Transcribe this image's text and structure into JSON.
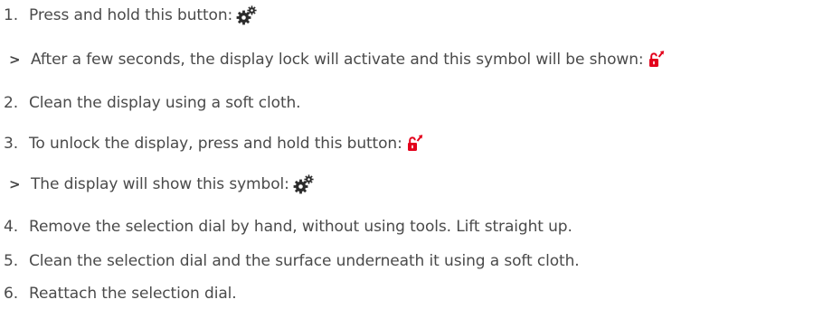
{
  "steps": [
    {
      "marker": "1.",
      "text": "Press and hold this button:",
      "icon": "gear-icon"
    },
    {
      "marker": ">",
      "text": "After a few seconds, the display lock will activate and this symbol will be shown:",
      "icon": "lock-open-icon"
    },
    {
      "marker": "2.",
      "text": "Clean the display using a soft cloth."
    },
    {
      "marker": "3.",
      "text": "To unlock the display, press and hold this button:",
      "icon": "lock-open-icon"
    },
    {
      "marker": ">",
      "text": "The display will show this symbol:",
      "icon": "gear-icon"
    },
    {
      "marker": "4.",
      "text": "Remove the selection dial by hand, without using tools. Lift straight up."
    },
    {
      "marker": "5.",
      "text": "Clean the selection dial and the surface underneath it using a soft cloth."
    },
    {
      "marker": "6.",
      "text": "Reattach the selection dial."
    }
  ],
  "colors": {
    "text": "#4a4a4a",
    "gear_icon": "#2b2b2b",
    "lock_icon": "#e3001b"
  }
}
